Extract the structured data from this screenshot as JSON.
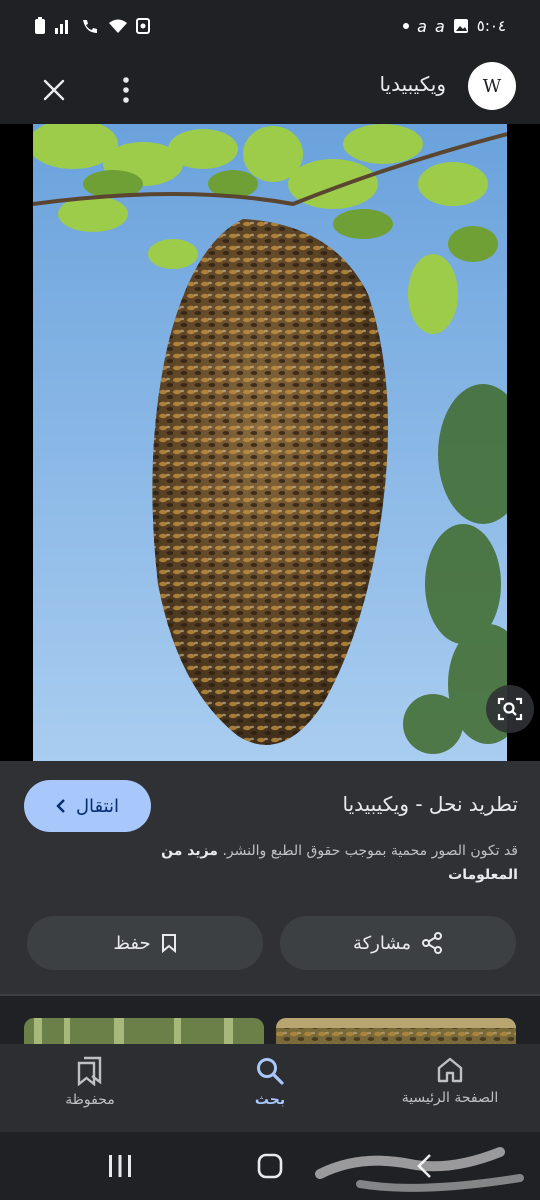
{
  "status_bar": {
    "time": "٥:٠٤"
  },
  "header": {
    "site_name": "ويكيبيديا",
    "site_logo_letter": "W",
    "close_icon": "close-icon",
    "more_icon": "more-vertical-icon"
  },
  "image": {
    "subject": "bee swarm hanging from tree branch",
    "lens_icon": "lens-search-icon"
  },
  "result": {
    "title": "تطريد نحل - ويكيبيديا",
    "visit_label": "انتقال",
    "notice_text": "قد تكون الصور محمية بموجب حقوق الطبع والنشر.",
    "notice_link": "مزيد من المعلومات",
    "share_label": "مشاركة",
    "save_label": "حفظ"
  },
  "bottom_nav": {
    "items": [
      {
        "label": "محفوظة",
        "icon": "bookmarks-icon"
      },
      {
        "label": "بحث",
        "icon": "search-icon",
        "active": true
      },
      {
        "label": "الصفحة الرئيسية",
        "icon": "home-icon"
      }
    ]
  },
  "colors": {
    "background": "#202124",
    "panel": "#303134",
    "accent": "#a8c7fa",
    "button": "#3c4043"
  }
}
